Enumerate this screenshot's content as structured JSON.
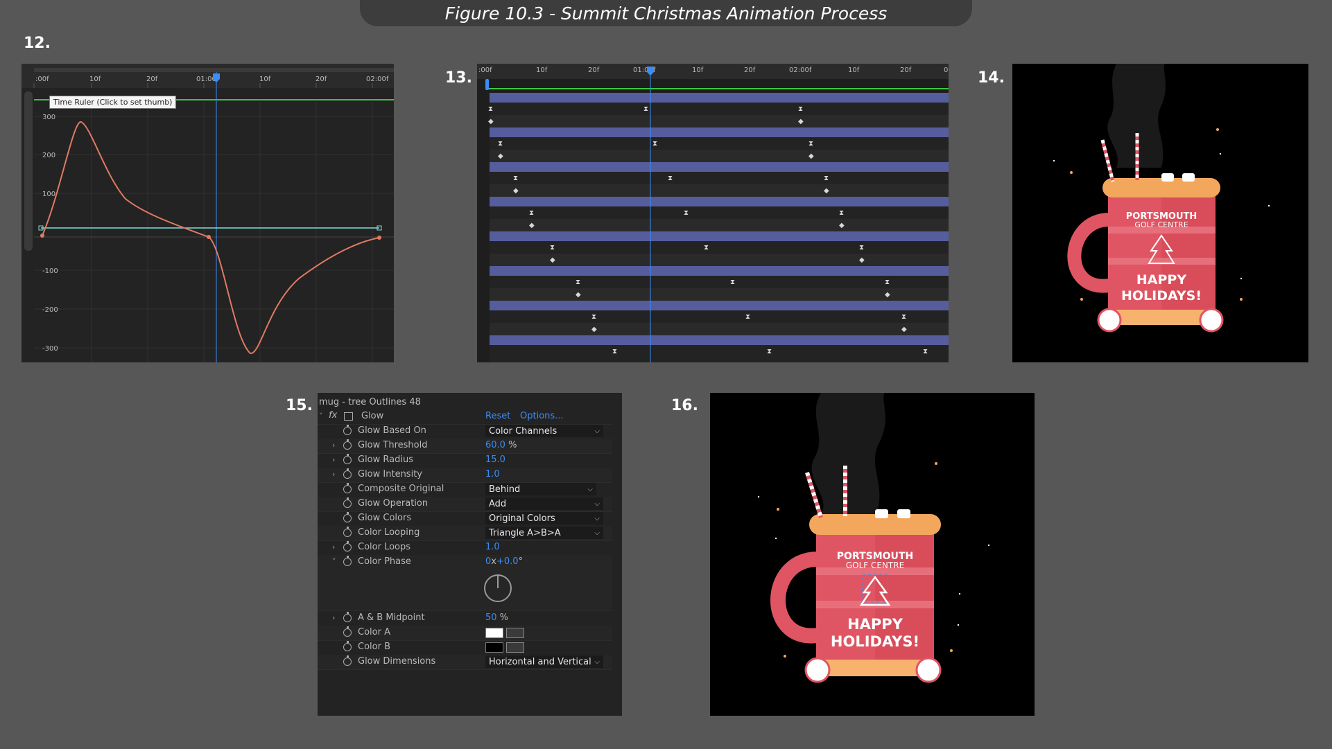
{
  "banner": {
    "title": "Figure 10.3 - Summit Christmas Animation Process"
  },
  "steps": {
    "s12": "12.",
    "s13": "13.",
    "s14": "14.",
    "s15": "15.",
    "s16": "16."
  },
  "graph_editor": {
    "ruler_labels": [
      ":00f",
      "10f",
      "20f",
      "01:00f",
      "10f",
      "20f",
      "02:00f"
    ],
    "tooltip": "Time Ruler (Click to set thumb)",
    "y_labels": [
      "300",
      "200",
      "100",
      "-100",
      "-200",
      "-300"
    ],
    "curve_color": "#e07a63"
  },
  "timeline": {
    "ruler_labels": [
      ":00f",
      "10f",
      "20f",
      "01:00f",
      "10f",
      "20f",
      "02:00f",
      "10f",
      "20f",
      "0"
    ],
    "layer_color": "#565d9c"
  },
  "effect_controls": {
    "layer_title": "mug - tree Outlines 48",
    "effect_name": "Glow",
    "reset": "Reset",
    "options": "Options...",
    "rows": [
      {
        "label": "Glow Based On",
        "kind": "dropdown",
        "value": "Color Channels"
      },
      {
        "label": "Glow Threshold",
        "kind": "value",
        "value": "60.0",
        "unit": " %"
      },
      {
        "label": "Glow Radius",
        "kind": "value",
        "value": "15.0",
        "unit": ""
      },
      {
        "label": "Glow Intensity",
        "kind": "value",
        "value": "1.0",
        "unit": ""
      },
      {
        "label": "Composite Original",
        "kind": "dropdown",
        "value": "Behind"
      },
      {
        "label": "Glow Operation",
        "kind": "dropdown",
        "value": "Add"
      },
      {
        "label": "Glow Colors",
        "kind": "dropdown",
        "value": "Original Colors"
      },
      {
        "label": "Color Looping",
        "kind": "dropdown",
        "value": "Triangle A>B>A"
      },
      {
        "label": "Color Loops",
        "kind": "value",
        "value": "1.0",
        "unit": ""
      },
      {
        "label": "Color Phase",
        "kind": "value",
        "value": "0",
        "unit": "x",
        "value2": "+0.0",
        "unit2": "°"
      },
      {
        "label": "A & B Midpoint",
        "kind": "value",
        "value": "50",
        "unit": " %"
      },
      {
        "label": "Color A",
        "kind": "color",
        "value": "#ffffff"
      },
      {
        "label": "Color B",
        "kind": "color",
        "value": "#000000"
      },
      {
        "label": "Glow Dimensions",
        "kind": "dropdown",
        "value": "Horizontal and Vertical"
      }
    ]
  },
  "mug_art": {
    "brand_line1": "PORTSMOUTH",
    "brand_line2": "GOLF CENTRE",
    "greeting_line1": "HAPPY",
    "greeting_line2": "HOLIDAYS!",
    "colors": {
      "mug": "#e05563",
      "rim": "#f3a75d",
      "sock": "#f7b26e",
      "bg": "#000000"
    }
  }
}
